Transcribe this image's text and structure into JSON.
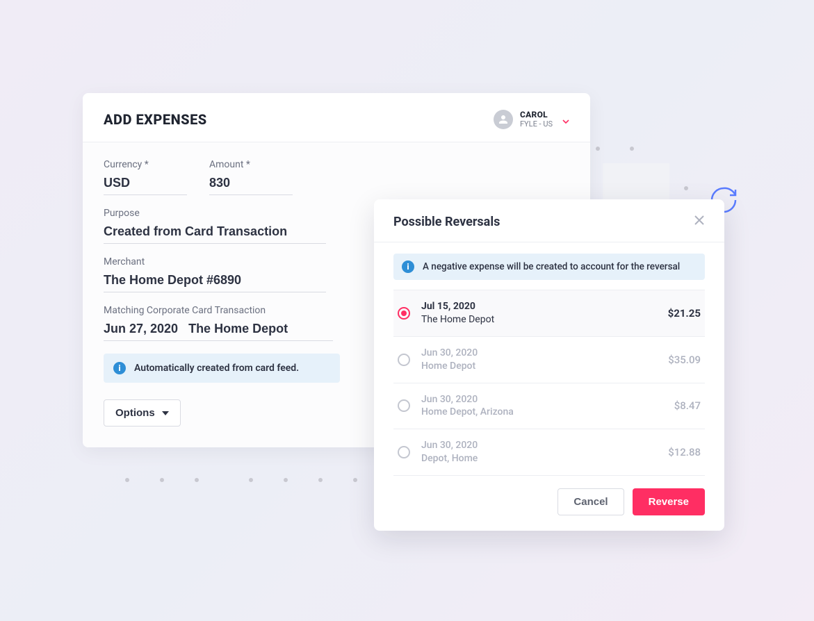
{
  "colors": {
    "accent": "#ff2e63",
    "info": "#2e8ed6"
  },
  "expenses": {
    "title": "ADD EXPENSES",
    "user": {
      "name": "CAROL",
      "org": "FYLE - US"
    },
    "fields": {
      "currency_label": "Currency *",
      "currency_value": "USD",
      "amount_label": "Amount *",
      "amount_value": "830",
      "purpose_label": "Purpose",
      "purpose_value": "Created from Card Transaction",
      "merchant_label": "Merchant",
      "merchant_value": "The Home Depot #6890",
      "match_label": "Matching Corporate Card Transaction",
      "match_value": "Jun 27, 2020   The Home Depot"
    },
    "info_banner": "Automatically created from card feed.",
    "options_label": "Options"
  },
  "reversals": {
    "title": "Possible Reversals",
    "info": "A negative expense will be created to account for the reversal",
    "items": [
      {
        "date": "Jul 15, 2020",
        "merchant": "The Home Depot",
        "amount": "$21.25",
        "selected": true
      },
      {
        "date": "Jun 30, 2020",
        "merchant": "Home Depot",
        "amount": "$35.09",
        "selected": false
      },
      {
        "date": "Jun 30, 2020",
        "merchant": "Home Depot, Arizona",
        "amount": "$8.47",
        "selected": false
      },
      {
        "date": "Jun 30, 2020",
        "merchant": "Depot, Home",
        "amount": "$12.88",
        "selected": false
      }
    ],
    "cancel_label": "Cancel",
    "reverse_label": "Reverse"
  }
}
